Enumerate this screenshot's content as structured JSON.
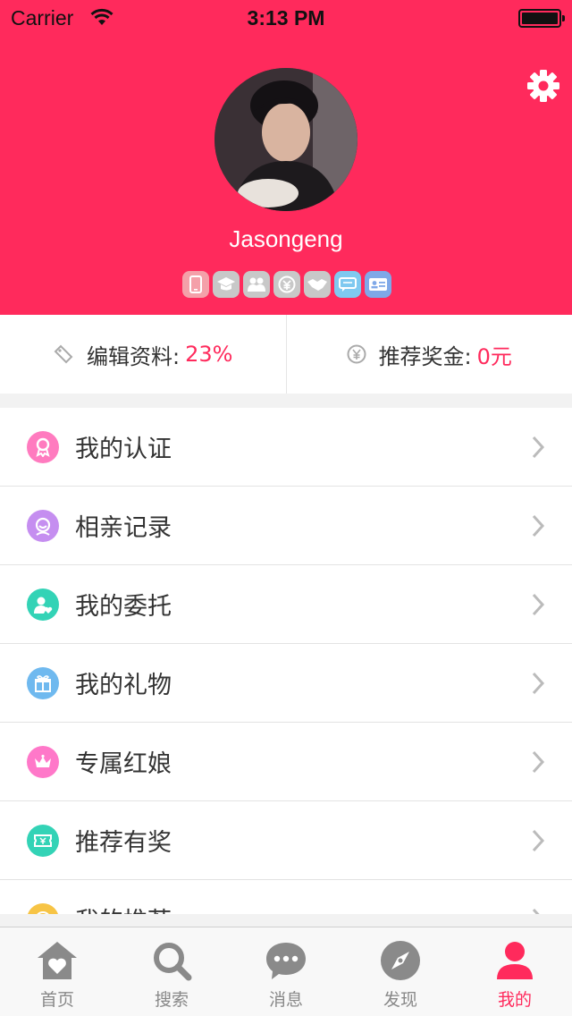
{
  "status_bar": {
    "carrier": "Carrier",
    "time": "3:13 PM"
  },
  "profile": {
    "username": "Jasongeng",
    "badges": [
      {
        "icon": "phone-icon",
        "color": "#f4a0a9"
      },
      {
        "icon": "graduation-cap-icon",
        "color": "#c8c8c8"
      },
      {
        "icon": "couple-icon",
        "color": "#c8c8c8"
      },
      {
        "icon": "money-icon",
        "color": "#c8c8c8"
      },
      {
        "icon": "handshake-icon",
        "color": "#c8c8c8"
      },
      {
        "icon": "chat-icon",
        "color": "#7fc9f0"
      },
      {
        "icon": "id-card-icon",
        "color": "#7fa8e8"
      }
    ]
  },
  "stats": {
    "edit_label": "编辑资料:",
    "edit_value": "23%",
    "bonus_label": "推荐奖金:",
    "bonus_value": "0元"
  },
  "menu": [
    {
      "label": "我的认证",
      "icon": "ribbon-icon",
      "color": "#ff7bbf"
    },
    {
      "label": "相亲记录",
      "icon": "face-icon",
      "color": "#c58ef0"
    },
    {
      "label": "我的委托",
      "icon": "person-heart-icon",
      "color": "#33d3b6"
    },
    {
      "label": "我的礼物",
      "icon": "gift-icon",
      "color": "#6fb9ef"
    },
    {
      "label": "专属红娘",
      "icon": "crown-icon",
      "color": "#ff78c9"
    },
    {
      "label": "推荐有奖",
      "icon": "ticket-icon",
      "color": "#33d3b6"
    },
    {
      "label": "我的推荐",
      "icon": "smile-icon",
      "color": "#f7c445"
    }
  ],
  "tabs": [
    {
      "label": "首页",
      "icon": "home-heart-icon"
    },
    {
      "label": "搜索",
      "icon": "search-icon"
    },
    {
      "label": "消息",
      "icon": "message-bubble-icon"
    },
    {
      "label": "发现",
      "icon": "compass-icon"
    },
    {
      "label": "我的",
      "icon": "user-icon",
      "active": true
    }
  ],
  "colors": {
    "accent": "#ff2a5c",
    "tab_inactive": "#8a8a8a"
  }
}
